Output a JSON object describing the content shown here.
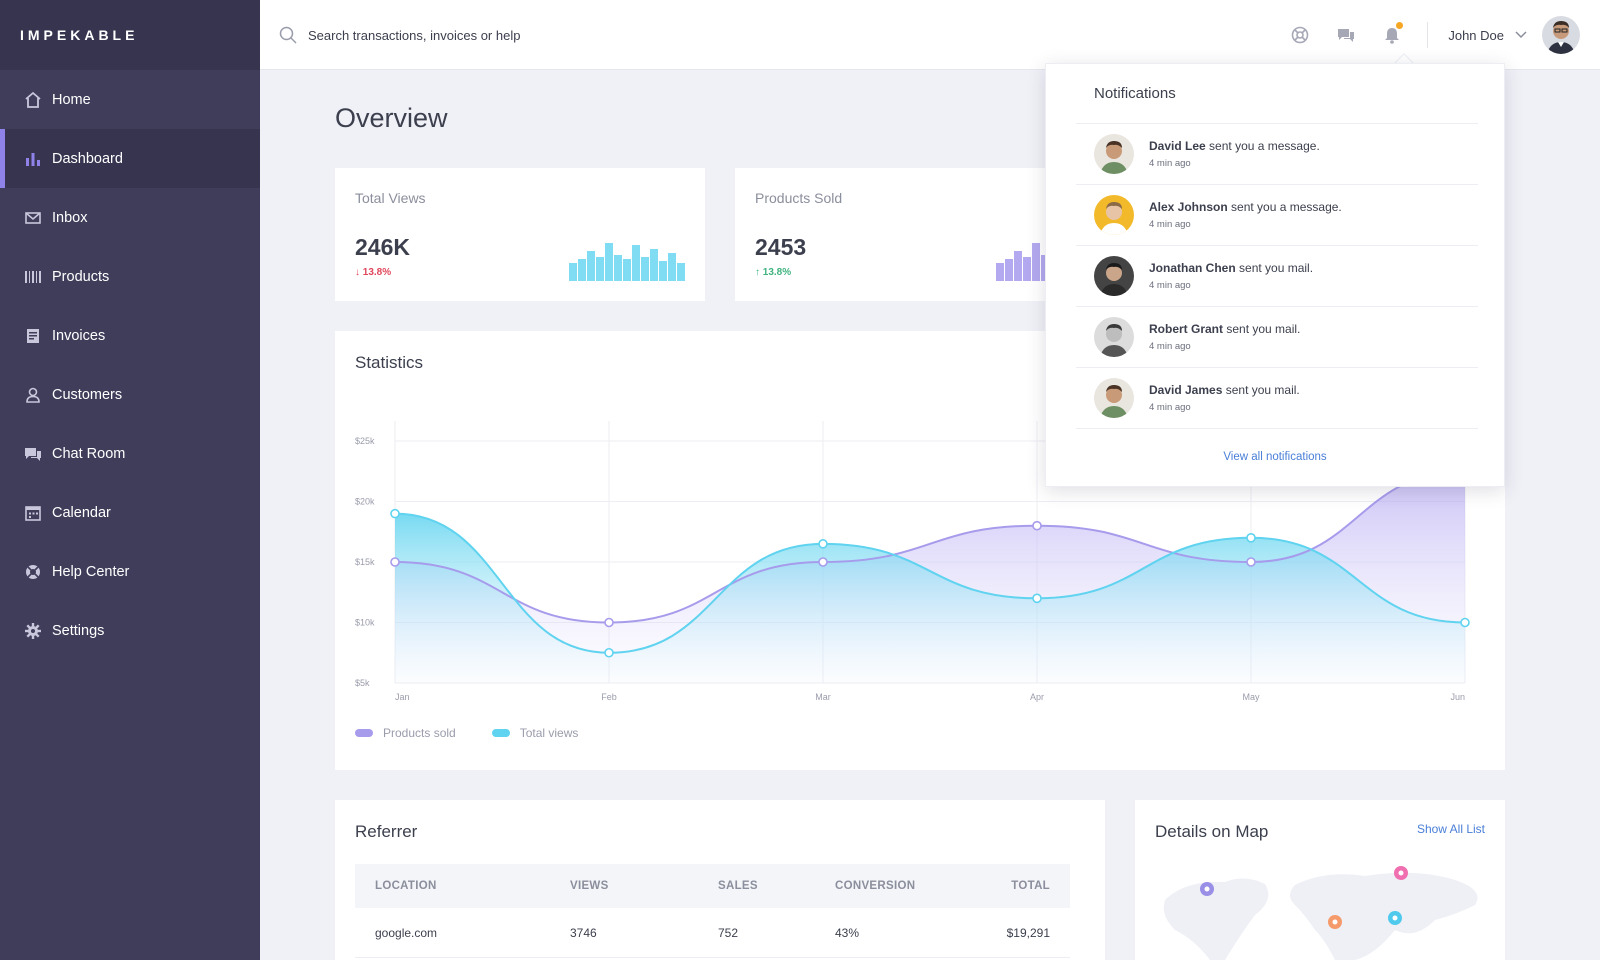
{
  "brand": "IMPEKABLE",
  "colors": {
    "sidebar": "#3f3d5a",
    "accent": "#8f83ea",
    "cyan": "#5fd3ef",
    "purple": "#a79bec",
    "down": "#e0475a",
    "up": "#3fb37f"
  },
  "sidebar": {
    "items": [
      {
        "label": "Home",
        "icon": "home-icon"
      },
      {
        "label": "Dashboard",
        "icon": "bar-chart-icon",
        "active": true
      },
      {
        "label": "Inbox",
        "icon": "mail-icon"
      },
      {
        "label": "Products",
        "icon": "barcode-icon"
      },
      {
        "label": "Invoices",
        "icon": "invoice-icon"
      },
      {
        "label": "Customers",
        "icon": "user-icon"
      },
      {
        "label": "Chat Room",
        "icon": "chat-icon"
      },
      {
        "label": "Calendar",
        "icon": "calendar-icon"
      },
      {
        "label": "Help Center",
        "icon": "lifebuoy-icon"
      },
      {
        "label": "Settings",
        "icon": "gear-icon"
      }
    ]
  },
  "topbar": {
    "search_placeholder": "Search transactions, invoices or help",
    "user_name": "John Doe"
  },
  "main": {
    "title": "Overview",
    "stats": [
      {
        "label": "Total Views",
        "value": "246K",
        "change": "13.8%",
        "direction": "down",
        "bars": [
          0.45,
          0.55,
          0.75,
          0.6,
          0.95,
          0.65,
          0.55,
          0.9,
          0.6,
          0.8,
          0.5,
          0.7,
          0.45
        ]
      },
      {
        "label": "Products Sold",
        "value": "2453",
        "change": "13.8%",
        "direction": "up",
        "bars": [
          0.45,
          0.55,
          0.75,
          0.6,
          0.95,
          0.65,
          0.55,
          0.9
        ]
      }
    ],
    "statistics_title": "Statistics",
    "referrer": {
      "title": "Referrer",
      "columns": [
        "LOCATION",
        "VIEWS",
        "SALES",
        "CONVERSION",
        "TOTAL"
      ],
      "rows": [
        [
          "google.com",
          "3746",
          "752",
          "43%",
          "$19,291"
        ]
      ]
    },
    "map": {
      "title": "Details on Map",
      "link": "Show All List"
    }
  },
  "chart_data": {
    "type": "area",
    "categories": [
      "Jan",
      "Feb",
      "Mar",
      "Apr",
      "May",
      "Jun"
    ],
    "yticks": [
      "$5k",
      "$10k",
      "$15k",
      "$20k",
      "$25k"
    ],
    "ylim": [
      5000,
      25000
    ],
    "legend_placement": "bottom-left",
    "series": [
      {
        "name": "Products sold",
        "color": "#a79bec",
        "values": [
          15000,
          10000,
          15000,
          18000,
          15000,
          22500
        ]
      },
      {
        "name": "Total views",
        "color": "#5fd3ef",
        "values": [
          19000,
          7500,
          16500,
          12000,
          17000,
          10000
        ]
      }
    ]
  },
  "notifications": {
    "title": "Notifications",
    "items": [
      {
        "name": "David Lee",
        "text": "sent you a message.",
        "time": "4 min ago"
      },
      {
        "name": "Alex Johnson",
        "text": "sent you a message.",
        "time": "4 min ago"
      },
      {
        "name": "Jonathan Chen",
        "text": "sent you mail.",
        "time": "4 min ago"
      },
      {
        "name": "Robert Grant",
        "text": "sent you mail.",
        "time": "4 min ago"
      },
      {
        "name": "David James",
        "text": "sent you mail.",
        "time": "4 min ago"
      }
    ],
    "view_all": "View all notifications"
  }
}
